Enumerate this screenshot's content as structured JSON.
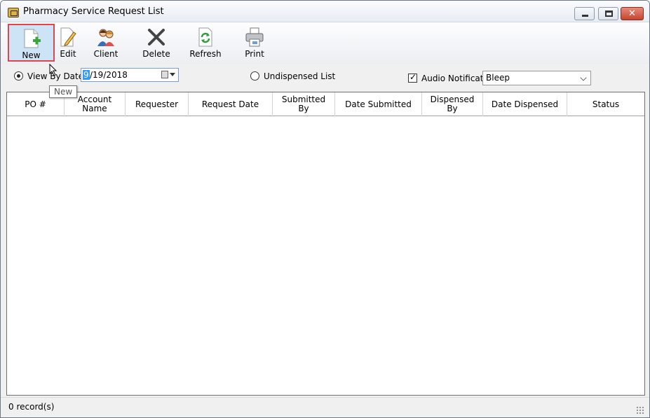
{
  "window": {
    "title": "Pharmacy Service Request List",
    "controls": [
      "minimize",
      "maximize",
      "close"
    ]
  },
  "toolbar": {
    "buttons": [
      {
        "label": "New",
        "icon": "new-document-plus-icon"
      },
      {
        "label": "Edit",
        "icon": "edit-pencil-icon"
      },
      {
        "label": "Client",
        "icon": "client-people-icon"
      },
      {
        "label": "Delete",
        "icon": "delete-x-icon"
      },
      {
        "label": "Refresh",
        "icon": "refresh-icon"
      },
      {
        "label": "Print",
        "icon": "printer-icon"
      }
    ]
  },
  "tooltip": {
    "text": "New"
  },
  "filters": {
    "view_by_date_label": "View By Date",
    "view_by_date_checked": true,
    "date_selected_part": "9",
    "date_value": "/19/2018",
    "undispensed_label": "Undispensed List",
    "undispensed_checked": false,
    "audio_notification_label": "Audio Notification",
    "audio_notification_checked": true,
    "audio_sound": "Bleep"
  },
  "grid": {
    "columns": [
      {
        "line1": "PO #",
        "line2": ""
      },
      {
        "line1": "Account",
        "line2": "Name"
      },
      {
        "line1": "Requester",
        "line2": ""
      },
      {
        "line1": "Request Date",
        "line2": ""
      },
      {
        "line1": "Submitted",
        "line2": "By"
      },
      {
        "line1": "Date Submitted",
        "line2": ""
      },
      {
        "line1": "Dispensed",
        "line2": "By"
      },
      {
        "line1": "Date Dispensed",
        "line2": ""
      },
      {
        "line1": "Status",
        "line2": ""
      }
    ],
    "rows": []
  },
  "status": {
    "records": "0 record(s)"
  },
  "colors": {
    "accent_highlight": "#cde4f7",
    "annotation_box": "#e3434c",
    "selection": "#3399ff"
  }
}
